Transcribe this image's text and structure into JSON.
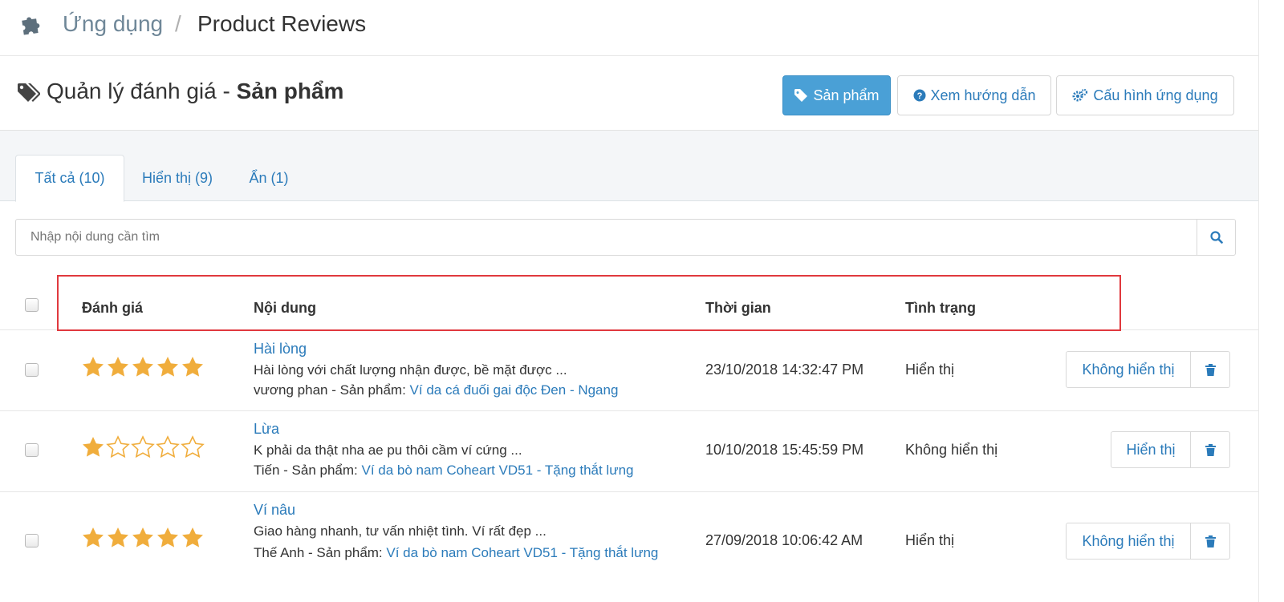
{
  "breadcrumb": {
    "parent": "Ứng dụng",
    "separator": "/",
    "current": "Product Reviews"
  },
  "header": {
    "title_prefix": "Quản lý đánh giá - ",
    "title_strong": "Sản phẩm",
    "buttons": {
      "products": "Sản phẩm",
      "guide": "Xem hướng dẫn",
      "config": "Cấu hình ứng dụng"
    }
  },
  "tabs": [
    {
      "label": "Tất cả (10)",
      "active": true
    },
    {
      "label": "Hiển thị (9)",
      "active": false
    },
    {
      "label": "Ẩn (1)",
      "active": false
    }
  ],
  "search": {
    "placeholder": "Nhập nội dung cần tìm",
    "value": ""
  },
  "table": {
    "columns": {
      "rating": "Đánh giá",
      "content": "Nội dung",
      "time": "Thời gian",
      "status": "Tình trạng"
    },
    "rows": [
      {
        "stars": 5,
        "title": "Hài lòng",
        "text": "Hài lòng với chất lượng nhận được, bề mặt được ...",
        "author_prefix": "vương phan - Sản phẩm: ",
        "product": "Ví da cá đuối gai độc Đen - Ngang",
        "time": "23/10/2018 14:32:47 PM",
        "status": "Hiển thị",
        "action": "Không hiển thị"
      },
      {
        "stars": 1,
        "title": "Lừa",
        "text": "K phải da thật nha ae pu thôi cầm ví cứng ...",
        "author_prefix": "Tiến - Sản phẩm: ",
        "product": "Ví da bò nam Coheart VD51 - Tặng thắt lưng",
        "time": "10/10/2018 15:45:59 PM",
        "status": "Không hiển thị",
        "action": "Hiển thị"
      },
      {
        "stars": 5,
        "title": "Ví nâu",
        "text": "Giao hàng nhanh, tư vấn nhiệt tình. Ví rất đẹp ...",
        "author_prefix": "Thế Anh - Sản phẩm: ",
        "product": "Ví da bò nam Coheart VD51 - Tặng thắt lưng",
        "time": "27/09/2018 10:06:42 AM",
        "status": "Hiển thị",
        "action": "Không hiển thị"
      }
    ]
  },
  "colors": {
    "primary": "#4aa0d6",
    "link": "#2b7bba",
    "star": "#f0ad3c",
    "highlight": "#e0393e"
  }
}
